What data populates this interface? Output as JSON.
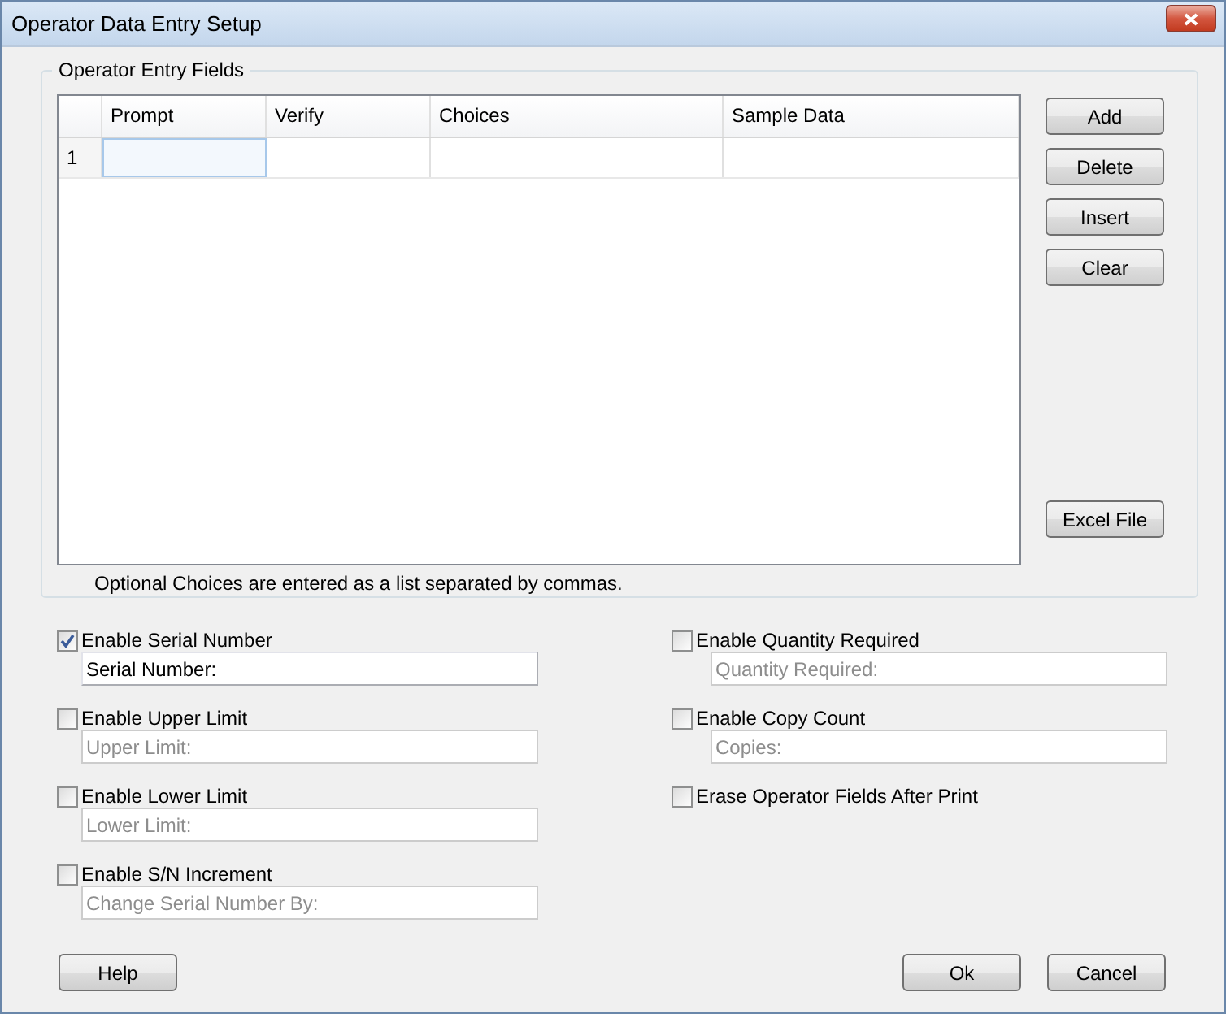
{
  "window": {
    "title": "Operator Data Entry Setup"
  },
  "group": {
    "title": "Operator Entry Fields",
    "table": {
      "columns": [
        "Prompt",
        "Verify",
        "Choices",
        "Sample Data"
      ],
      "rows": [
        {
          "label": "1",
          "cells": [
            {
              "selected": true
            },
            {
              "selected": false
            },
            {
              "selected": false
            },
            {
              "selected": false
            }
          ]
        }
      ]
    },
    "buttons": [
      "Add",
      "Delete",
      "Insert",
      "Clear"
    ],
    "file_button": "Excel File",
    "note": "Optional Choices are entered as a list separated by commas."
  },
  "options_left": [
    {
      "label": "Enable Serial Number",
      "checked": true,
      "field": {
        "value": "Serial Number:",
        "disabled": false
      }
    },
    {
      "label": "Enable Upper Limit",
      "checked": false,
      "field": {
        "value": "Upper Limit:",
        "disabled": true
      }
    },
    {
      "label": "Enable Lower Limit",
      "checked": false,
      "field": {
        "value": "Lower Limit:",
        "disabled": true
      }
    },
    {
      "label": "Enable S/N Increment",
      "checked": false,
      "field": {
        "value": "Change Serial Number By:",
        "disabled": true
      }
    }
  ],
  "options_right": [
    {
      "label": "Enable Quantity Required",
      "checked": false,
      "field": {
        "value": "Quantity Required:",
        "disabled": true
      }
    },
    {
      "label": "Enable Copy Count",
      "checked": false,
      "field": {
        "value": "Copies:",
        "disabled": true
      }
    },
    {
      "label": "Erase Operator Fields After Print",
      "checked": false
    }
  ],
  "footer": {
    "left_buttons": [
      "Help"
    ],
    "right_buttons": [
      "Ok",
      "Cancel"
    ]
  }
}
